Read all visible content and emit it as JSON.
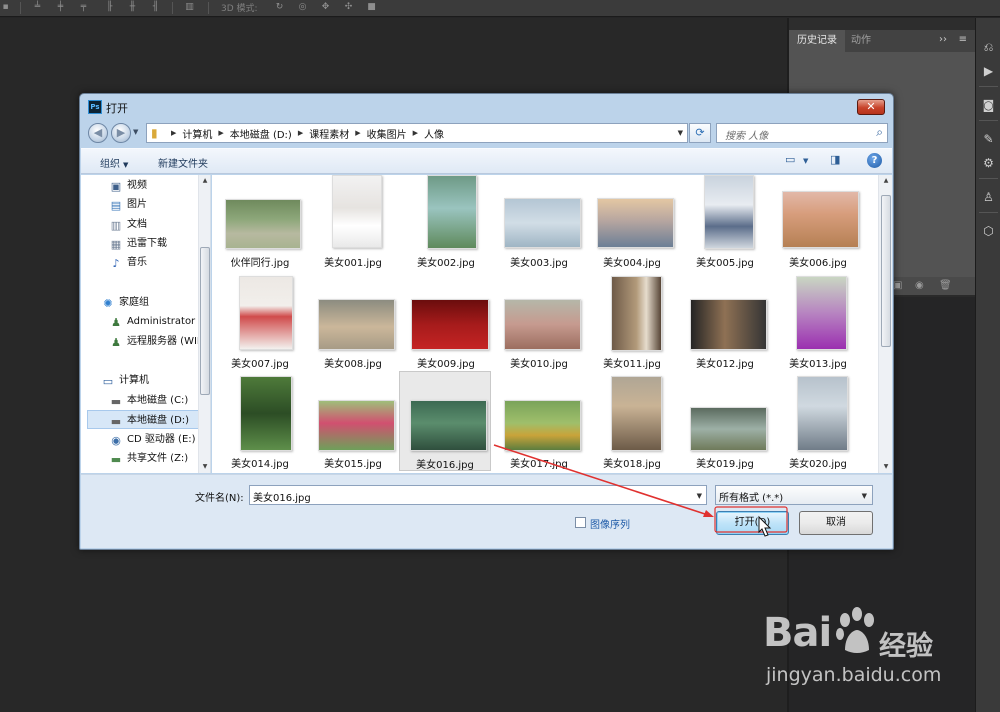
{
  "ps": {
    "mode_label": "3D 模式:",
    "panel_tabs": [
      "历史记录",
      "动作"
    ],
    "panel_collapse": "››",
    "panel_menu": "≡"
  },
  "dialog": {
    "title": "打开",
    "close_glyph": "✕",
    "breadcrumb": [
      "计算机",
      "本地磁盘 (D:)",
      "课程素材",
      "收集图片",
      "人像"
    ],
    "search_placeholder": "搜索 人像",
    "toolbar": {
      "organize": "组织",
      "new_folder": "新建文件夹",
      "help": "?"
    },
    "sidebar": {
      "items": [
        {
          "label": "视频",
          "icon": "video-library-icon"
        },
        {
          "label": "图片",
          "icon": "picture-library-icon"
        },
        {
          "label": "文档",
          "icon": "document-library-icon"
        },
        {
          "label": "迅雷下载",
          "icon": "library-icon"
        },
        {
          "label": "音乐",
          "icon": "music-library-icon"
        },
        {
          "label": "家庭组",
          "icon": "homegroup-icon"
        },
        {
          "label": "Administrator",
          "icon": "user-icon"
        },
        {
          "label": "远程服务器 (WIN-",
          "icon": "user-icon"
        },
        {
          "label": "计算机",
          "icon": "computer-icon"
        },
        {
          "label": "本地磁盘 (C:)",
          "icon": "drive-icon"
        },
        {
          "label": "本地磁盘 (D:)",
          "icon": "drive-icon"
        },
        {
          "label": "CD 驱动器 (E:)",
          "icon": "cd-drive-icon"
        },
        {
          "label": "共享文件 (Z:)",
          "icon": "network-drive-icon"
        }
      ],
      "selected": "本地磁盘 (D:)"
    },
    "files": [
      "伙伴同行.jpg",
      "美女001.jpg",
      "美女002.jpg",
      "美女003.jpg",
      "美女004.jpg",
      "美女005.jpg",
      "美女006.jpg",
      "美女007.jpg",
      "美女008.jpg",
      "美女009.jpg",
      "美女010.jpg",
      "美女011.jpg",
      "美女012.jpg",
      "美女013.jpg",
      "美女014.jpg",
      "美女015.jpg",
      "美女016.jpg",
      "美女017.jpg",
      "美女018.jpg",
      "美女019.jpg",
      "美女020.jpg"
    ],
    "selected_file": "美女016.jpg",
    "filename_label": "文件名(N):",
    "filename_value": "美女016.jpg",
    "filetype_value": "所有格式 (*.*)",
    "image_sequence_label": "图像序列",
    "open_button": "打开(O)",
    "cancel_button": "取消"
  },
  "watermark": {
    "brand_latin": "Bai",
    "brand_cn": "经验",
    "url": "jingyan.baidu.com"
  },
  "colors": {
    "ps_background": "#282828",
    "dialog_frame": "#bcd3ea",
    "selection": "#d7e7f7",
    "annotation_arrow": "#e0312f"
  }
}
